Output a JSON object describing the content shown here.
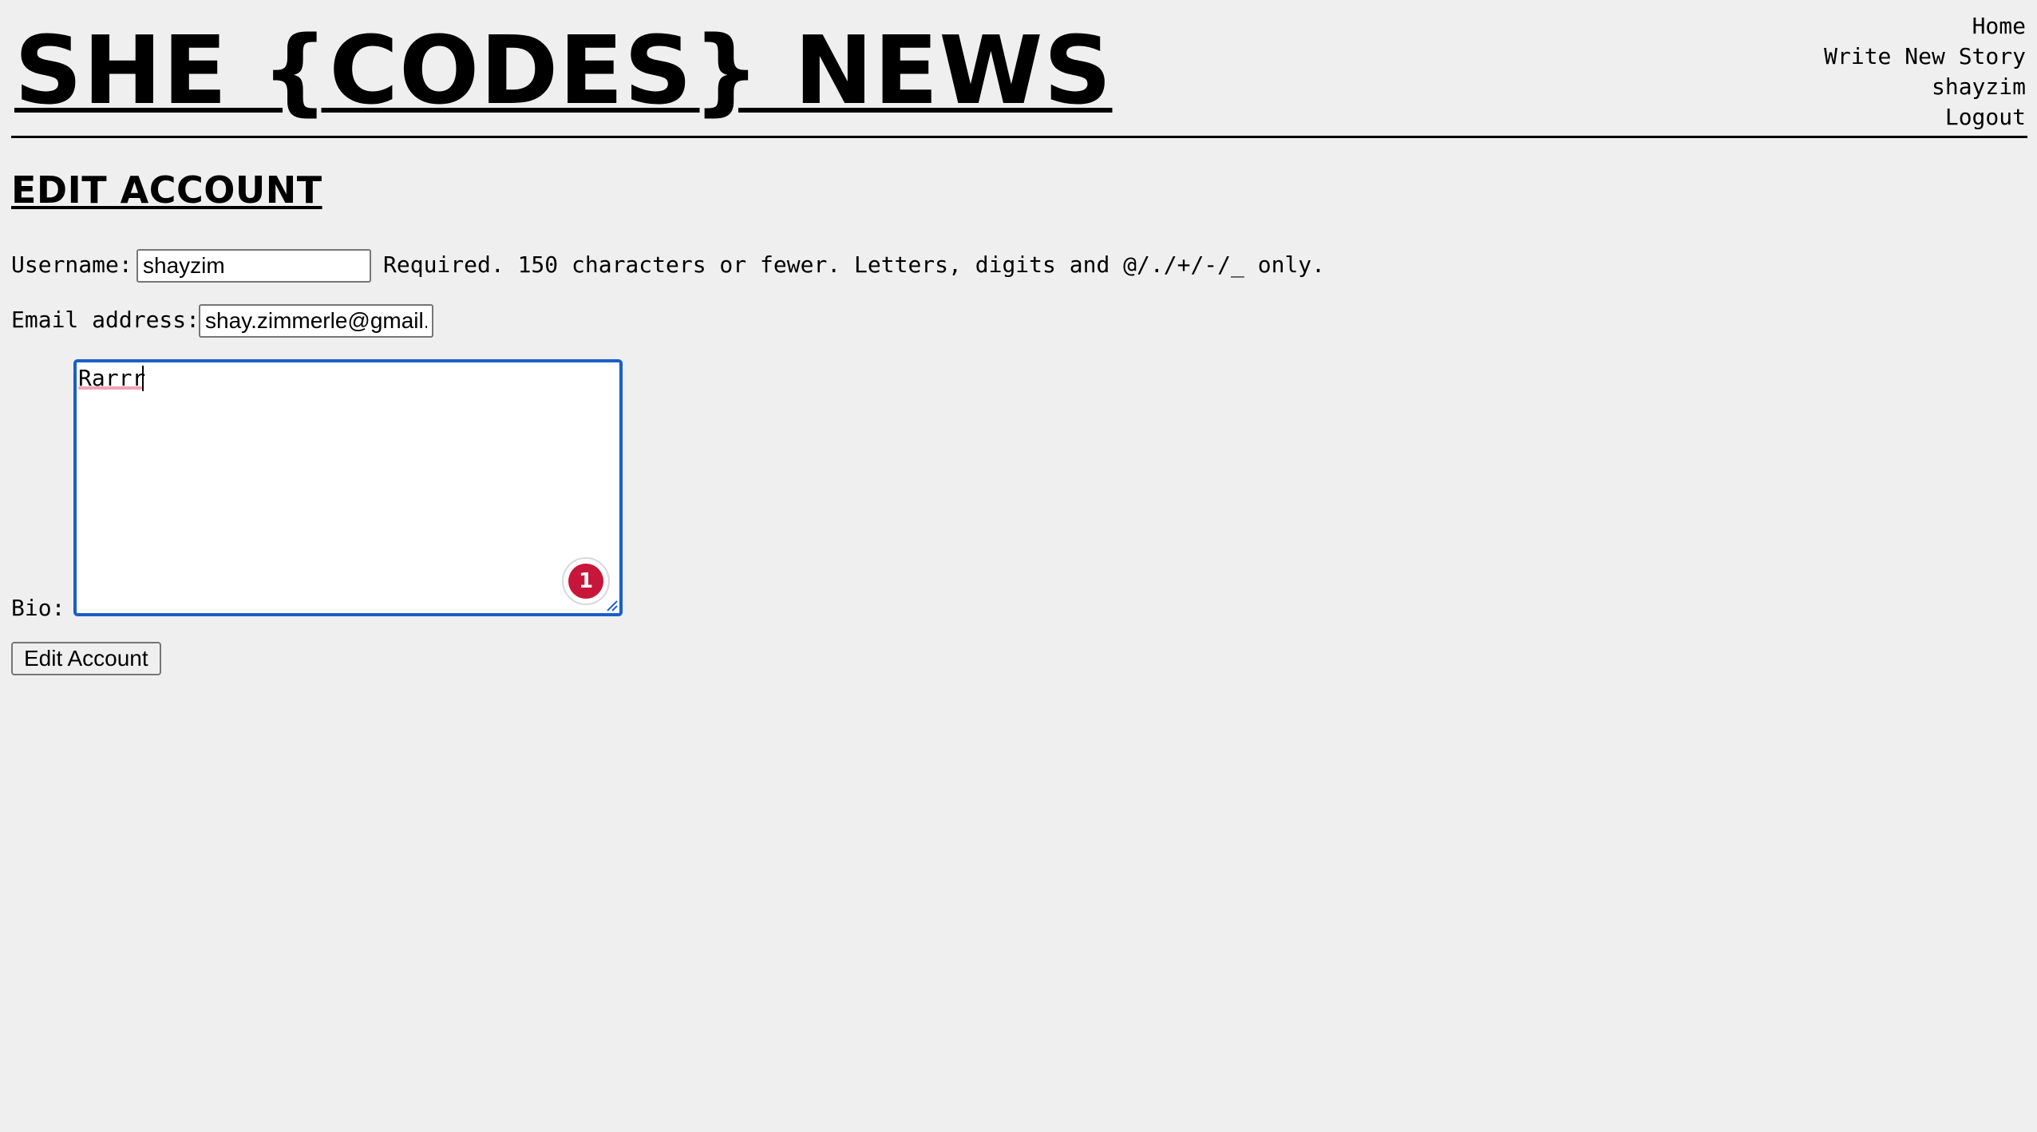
{
  "header": {
    "site_title": "SHE {CODES} NEWS",
    "nav": {
      "home": "Home",
      "write_new_story": "Write New Story",
      "username": "shayzim",
      "logout": "Logout"
    }
  },
  "main": {
    "heading": "EDIT ACCOUNT",
    "form": {
      "username_label": "Username:",
      "username_value": "shayzim",
      "username_help": "Required. 150 characters or fewer. Letters, digits and @/./+/-/_ only.",
      "email_label": "Email address:",
      "email_value": "shay.zimmerle@gmail.com",
      "bio_label": "Bio:",
      "bio_value": "Rarrr",
      "submit_label": "Edit Account"
    },
    "extension_badge": {
      "count": "1",
      "color": "#c8163a"
    }
  },
  "colors": {
    "background": "#efefef",
    "focus_border": "#1a5fc8",
    "spellcheck_underline": "#f2a3b3"
  }
}
